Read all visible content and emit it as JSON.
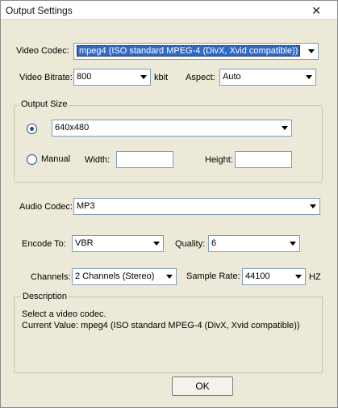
{
  "window": {
    "title": "Output Settings",
    "close_glyph": "✕"
  },
  "video": {
    "codec_label": "Video Codec:",
    "codec_value": "mpeg4 (ISO standard MPEG-4 (DivX, Xvid compatible))",
    "bitrate_label": "Video Bitrate:",
    "bitrate_value": "800",
    "bitrate_unit": "kbit",
    "aspect_label": "Aspect:",
    "aspect_value": "Auto"
  },
  "output_size": {
    "group_label": "Output Size",
    "preset_value": "640x480",
    "preset_selected": true,
    "manual_label": "Manual",
    "width_label": "Width:",
    "width_value": "",
    "height_label": "Height:",
    "height_value": ""
  },
  "audio": {
    "codec_label": "Audio Codec:",
    "codec_value": "MP3",
    "encode_label": "Encode To:",
    "encode_value": "VBR",
    "quality_label": "Quality:",
    "quality_value": "6",
    "channels_label": "Channels:",
    "channels_value": "2 Channels (Stereo)",
    "sample_rate_label": "Sample Rate:",
    "sample_rate_value": "44100",
    "sample_rate_unit": "HZ"
  },
  "description": {
    "group_label": "Description",
    "line1": "Select a video codec.",
    "line2": "Current Value: mpeg4 (ISO standard MPEG-4 (DivX, Xvid compatible))"
  },
  "buttons": {
    "ok_label": "OK"
  },
  "colors": {
    "dialog_bg": "#ece9d8",
    "selection": "#316ac5",
    "field_border": "#7f9db9"
  }
}
